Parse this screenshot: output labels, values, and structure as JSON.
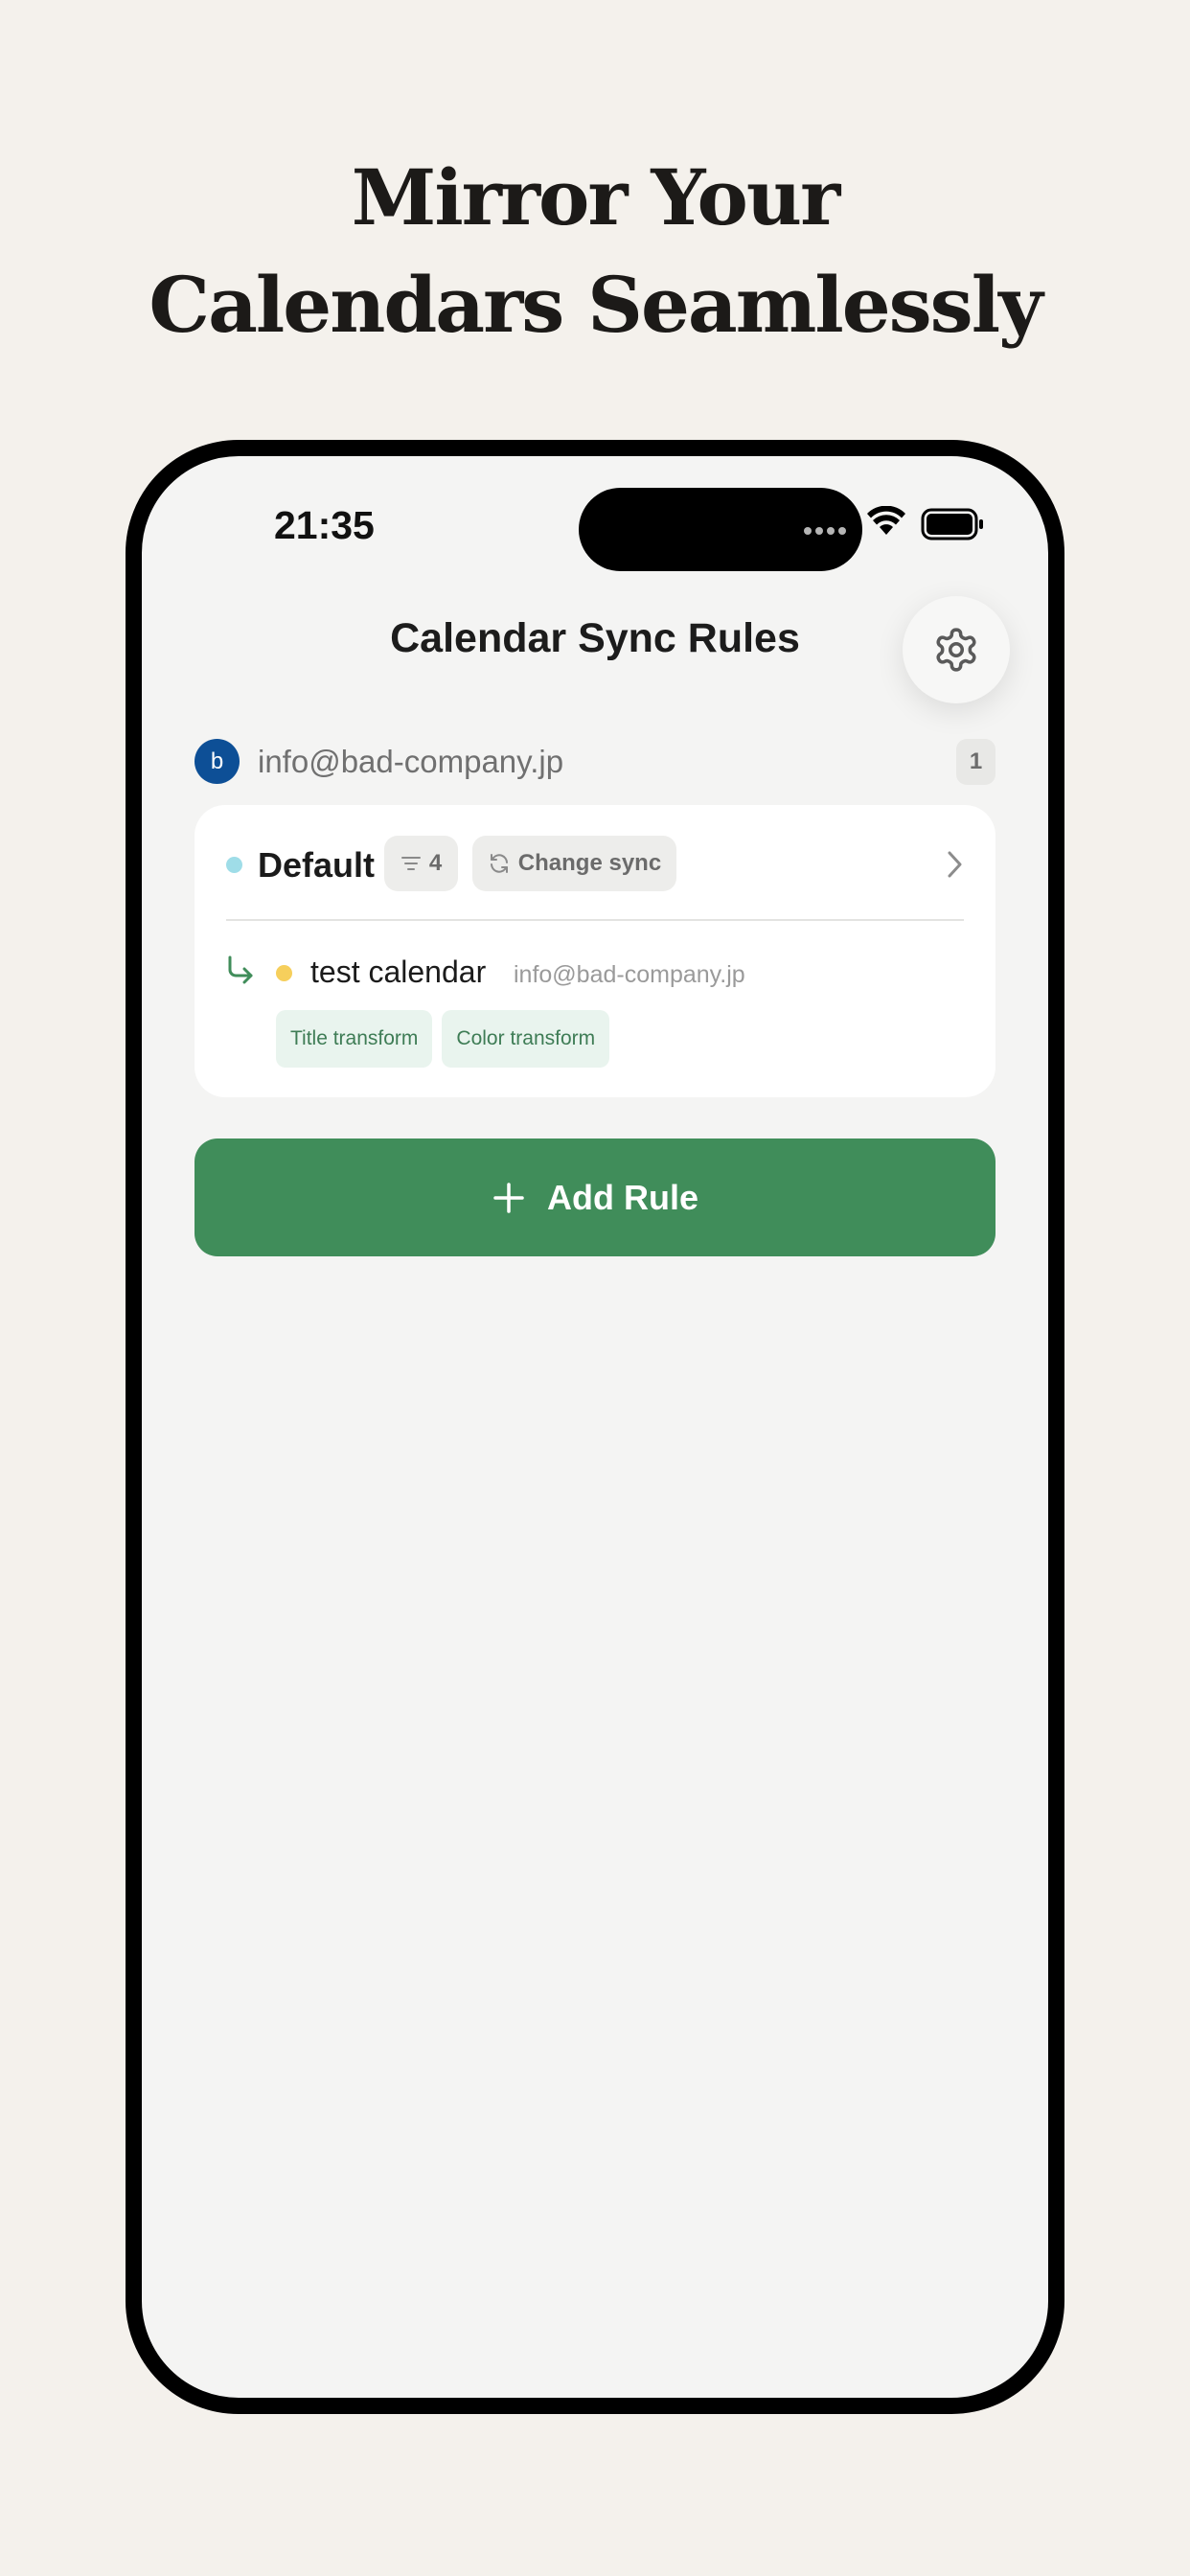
{
  "headline": {
    "line1": "Mirror Your",
    "line2": "Calendars Seamlessly"
  },
  "status_bar": {
    "time": "21:35"
  },
  "screen": {
    "title": "Calendar Sync Rules",
    "settings_icon": "gear-icon"
  },
  "account": {
    "avatar_letter": "b",
    "email": "info@bad-company.jp",
    "rule_count": "1",
    "avatar_color": "#0d4f96"
  },
  "rule": {
    "name": "Default",
    "source_color": "#9fdde8",
    "filter_count": "4",
    "sync_label": "Change sync",
    "destination": {
      "name": "test calendar",
      "email": "info@bad-company.jp",
      "color": "#f6cf5c",
      "tags": [
        "Title transform",
        "Color transform"
      ]
    }
  },
  "add_rule_label": "Add Rule",
  "colors": {
    "accent": "#408d5a",
    "tag_text": "#3e7c55",
    "tag_bg": "#e9f4ee"
  }
}
